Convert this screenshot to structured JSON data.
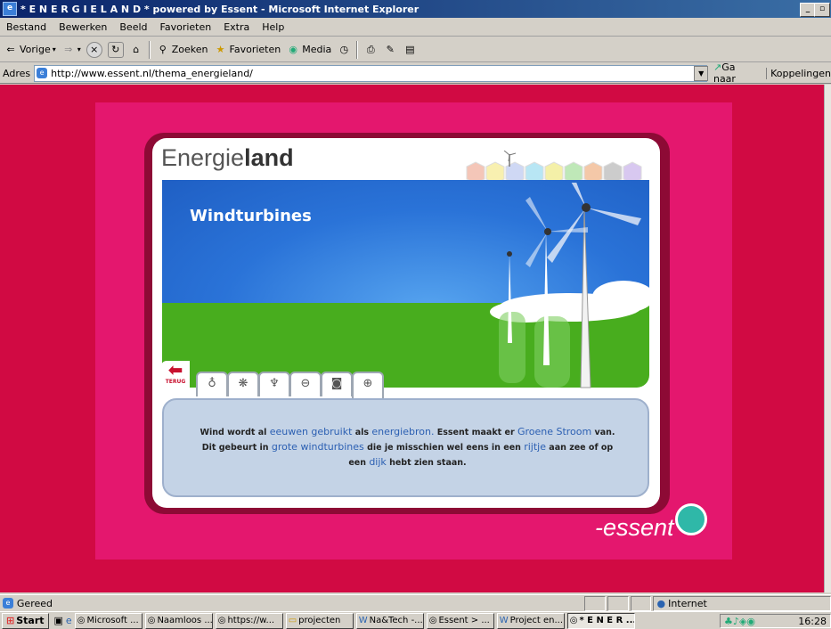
{
  "window": {
    "title": "* E N E R G I E L A N D * powered by Essent - Microsoft Internet Explorer"
  },
  "menu": {
    "items": [
      "Bestand",
      "Bewerken",
      "Beeld",
      "Favorieten",
      "Extra",
      "Help"
    ]
  },
  "toolbar": {
    "back": "Vorige",
    "search": "Zoeken",
    "favorites": "Favorieten",
    "media": "Media"
  },
  "address": {
    "label": "Adres",
    "url": "http://www.essent.nl/thema_energieland/",
    "go": "Ga naar",
    "links": "Koppelingen"
  },
  "page": {
    "logo_light": "Energie",
    "logo_bold": "land",
    "scene_title": "Windturbines",
    "back_label": "TERUG",
    "text": {
      "p1": "Wind wordt al ",
      "h1": "eeuwen gebruikt",
      "p2": " als ",
      "h2": "energiebron.",
      "p3": " Essent maakt er ",
      "h3": "Groene Stroom",
      "p4": " van.",
      "p5": "Dit gebeurt in ",
      "h4": "grote windturbines",
      "p6": " die je misschien wel eens in een ",
      "h5": "rijtje",
      "p7": " aan zee of op",
      "p8": "een ",
      "h6": "dijk",
      "p9": " hebt zien staan."
    },
    "brand": "-essent"
  },
  "status": {
    "text": "Gereed",
    "zone": "Internet"
  },
  "taskbar": {
    "start": "Start",
    "tasks": [
      "Microsoft ...",
      "Naamloos ...",
      "https://w...",
      "projecten",
      "Na&Tech -...",
      "Essent > ...",
      "Project en...",
      "* E N E R ..."
    ],
    "clock": "16:28"
  }
}
